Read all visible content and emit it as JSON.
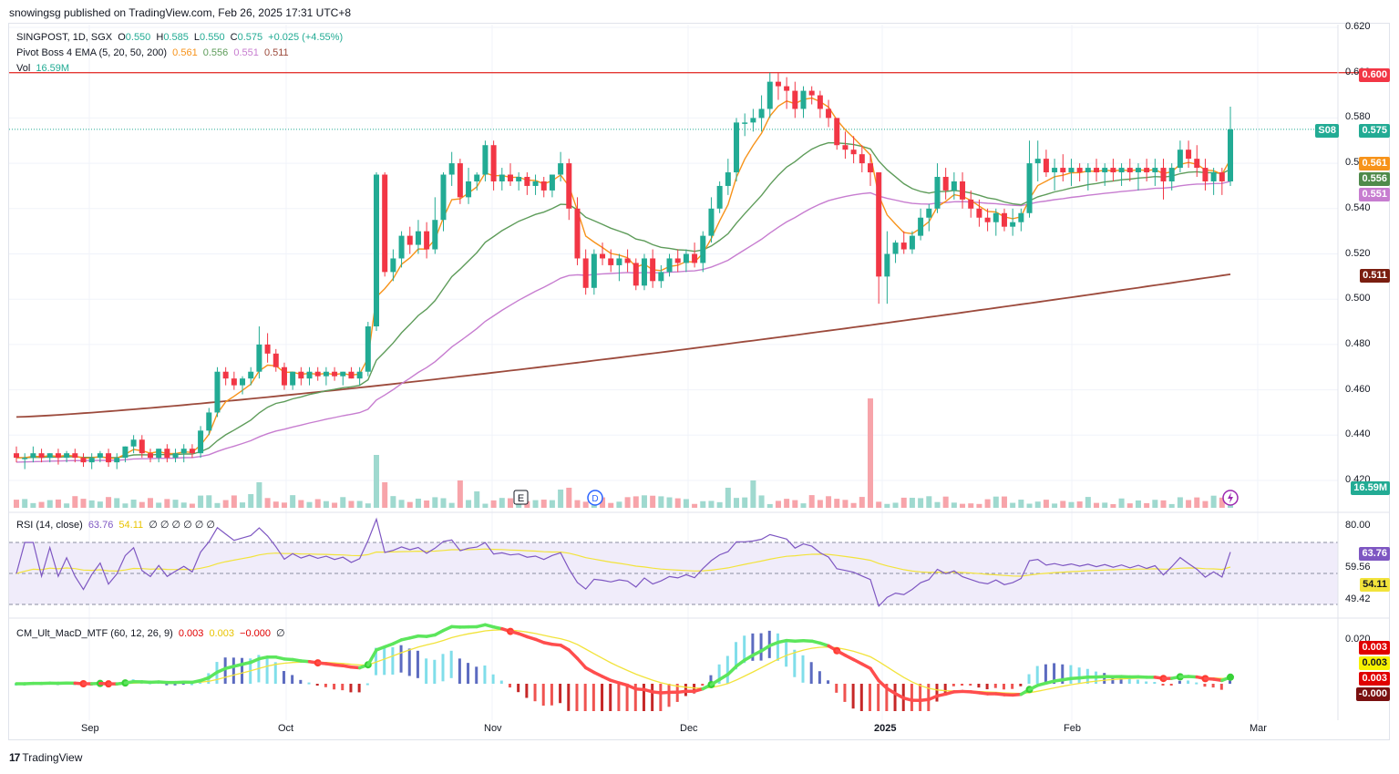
{
  "header": {
    "published": "snowingsg published on TradingView.com, Feb 26, 2025 17:31 UTC+8"
  },
  "brand": {
    "logo": "17",
    "name": "TradingView"
  },
  "legend": {
    "symbol": "SINGPOST, 1D, SGX",
    "o_label": "O",
    "o": "0.550",
    "h_label": "H",
    "h": "0.585",
    "l_label": "L",
    "l": "0.550",
    "c_label": "C",
    "c": "0.575",
    "change": "+0.025 (+4.55%)",
    "ema_title": "Pivot Boss 4 EMA (5, 20, 50, 200)",
    "ema5": "0.561",
    "ema20": "0.556",
    "ema50": "0.551",
    "ema200": "0.511",
    "vol_label": "Vol",
    "vol": "16.59M"
  },
  "rsi_legend": {
    "title": "RSI (14, close)",
    "rsi": "63.76",
    "ma": "54.11",
    "rest": "∅ ∅ ∅ ∅ ∅ ∅"
  },
  "macd_legend": {
    "title": "CM_Ult_MacD_MTF (60, 12, 26, 9)",
    "v1": "0.003",
    "v2": "0.003",
    "v3": "−0.000",
    "rest": "∅"
  },
  "price_axis": [
    "0.620",
    "0.600",
    "0.580",
    "0.560",
    "0.540",
    "0.520",
    "0.500",
    "0.480",
    "0.460",
    "0.440",
    "0.420"
  ],
  "rsi_axis": [
    "80.00",
    "59.56",
    "49.42"
  ],
  "macd_axis": [
    "0.020"
  ],
  "price_labels": {
    "hline": "0.600",
    "ticker": "S08",
    "last": "0.575",
    "ema5": "0.561",
    "ema20": "0.556",
    "ema50": "0.551",
    "ema200": "0.511",
    "vol": "16.59M",
    "rsi": "63.76",
    "rsi_ma": "54.11",
    "macd1": "0.003",
    "macd2": "0.003",
    "macd3": "0.003",
    "macd4": "-0.000"
  },
  "x_axis": [
    "Sep",
    "Oct",
    "Nov",
    "Dec",
    "2025",
    "Feb",
    "Mar"
  ],
  "events": {
    "earnings": "E",
    "dividend": "D"
  },
  "colors": {
    "up": "#22ab94",
    "down": "#f23645",
    "ema5": "#f7931a",
    "ema20": "#5e9c5a",
    "ema50": "#c77dd0",
    "ema200": "#9c4a3c",
    "hline": "#e53935",
    "rsi": "#7e57c2",
    "rsi_ma": "#f2e33b"
  },
  "chart_data": {
    "type": "candlestick",
    "hline": 0.6,
    "candles": [
      [
        0.432,
        0.435,
        0.428,
        0.43
      ],
      [
        0.43,
        0.432,
        0.425,
        0.43
      ],
      [
        0.43,
        0.435,
        0.428,
        0.432
      ],
      [
        0.432,
        0.434,
        0.428,
        0.43
      ],
      [
        0.43,
        0.432,
        0.428,
        0.432
      ],
      [
        0.432,
        0.434,
        0.427,
        0.43
      ],
      [
        0.43,
        0.433,
        0.428,
        0.432
      ],
      [
        0.432,
        0.434,
        0.428,
        0.43
      ],
      [
        0.43,
        0.432,
        0.426,
        0.428
      ],
      [
        0.428,
        0.432,
        0.425,
        0.43
      ],
      [
        0.43,
        0.433,
        0.428,
        0.432
      ],
      [
        0.432,
        0.434,
        0.426,
        0.428
      ],
      [
        0.428,
        0.432,
        0.425,
        0.43
      ],
      [
        0.43,
        0.435,
        0.428,
        0.435
      ],
      [
        0.435,
        0.44,
        0.432,
        0.438
      ],
      [
        0.438,
        0.44,
        0.43,
        0.432
      ],
      [
        0.432,
        0.434,
        0.428,
        0.43
      ],
      [
        0.43,
        0.434,
        0.428,
        0.434
      ],
      [
        0.434,
        0.436,
        0.428,
        0.43
      ],
      [
        0.43,
        0.434,
        0.428,
        0.432
      ],
      [
        0.432,
        0.436,
        0.428,
        0.434
      ],
      [
        0.434,
        0.436,
        0.43,
        0.432
      ],
      [
        0.432,
        0.444,
        0.43,
        0.442
      ],
      [
        0.442,
        0.452,
        0.44,
        0.45
      ],
      [
        0.45,
        0.47,
        0.448,
        0.468
      ],
      [
        0.468,
        0.47,
        0.462,
        0.465
      ],
      [
        0.465,
        0.468,
        0.46,
        0.462
      ],
      [
        0.462,
        0.466,
        0.458,
        0.465
      ],
      [
        0.465,
        0.47,
        0.462,
        0.468
      ],
      [
        0.468,
        0.488,
        0.465,
        0.48
      ],
      [
        0.48,
        0.485,
        0.472,
        0.476
      ],
      [
        0.476,
        0.478,
        0.468,
        0.47
      ],
      [
        0.47,
        0.472,
        0.46,
        0.462
      ],
      [
        0.462,
        0.468,
        0.46,
        0.468
      ],
      [
        0.468,
        0.47,
        0.462,
        0.465
      ],
      [
        0.465,
        0.47,
        0.462,
        0.468
      ],
      [
        0.468,
        0.47,
        0.464,
        0.466
      ],
      [
        0.466,
        0.47,
        0.462,
        0.468
      ],
      [
        0.468,
        0.47,
        0.464,
        0.466
      ],
      [
        0.466,
        0.468,
        0.462,
        0.468
      ],
      [
        0.468,
        0.47,
        0.465,
        0.465
      ],
      [
        0.465,
        0.47,
        0.462,
        0.468
      ],
      [
        0.468,
        0.49,
        0.466,
        0.488
      ],
      [
        0.488,
        0.556,
        0.486,
        0.555
      ],
      [
        0.555,
        0.556,
        0.51,
        0.512
      ],
      [
        0.512,
        0.522,
        0.508,
        0.518
      ],
      [
        0.518,
        0.53,
        0.514,
        0.528
      ],
      [
        0.528,
        0.532,
        0.52,
        0.524
      ],
      [
        0.524,
        0.535,
        0.52,
        0.53
      ],
      [
        0.53,
        0.534,
        0.518,
        0.522
      ],
      [
        0.522,
        0.545,
        0.52,
        0.535
      ],
      [
        0.535,
        0.556,
        0.53,
        0.555
      ],
      [
        0.555,
        0.565,
        0.55,
        0.56
      ],
      [
        0.56,
        0.562,
        0.542,
        0.545
      ],
      [
        0.545,
        0.558,
        0.542,
        0.552
      ],
      [
        0.552,
        0.556,
        0.548,
        0.555
      ],
      [
        0.555,
        0.57,
        0.552,
        0.568
      ],
      [
        0.568,
        0.57,
        0.548,
        0.552
      ],
      [
        0.552,
        0.558,
        0.548,
        0.555
      ],
      [
        0.555,
        0.56,
        0.55,
        0.552
      ],
      [
        0.552,
        0.556,
        0.548,
        0.554
      ],
      [
        0.554,
        0.556,
        0.546,
        0.55
      ],
      [
        0.55,
        0.555,
        0.546,
        0.552
      ],
      [
        0.552,
        0.554,
        0.545,
        0.548
      ],
      [
        0.548,
        0.555,
        0.545,
        0.555
      ],
      [
        0.555,
        0.565,
        0.552,
        0.56
      ],
      [
        0.56,
        0.562,
        0.535,
        0.54
      ],
      [
        0.54,
        0.545,
        0.515,
        0.518
      ],
      [
        0.518,
        0.522,
        0.502,
        0.505
      ],
      [
        0.505,
        0.522,
        0.502,
        0.52
      ],
      [
        0.52,
        0.525,
        0.515,
        0.518
      ],
      [
        0.518,
        0.522,
        0.512,
        0.515
      ],
      [
        0.515,
        0.52,
        0.508,
        0.518
      ],
      [
        0.518,
        0.522,
        0.512,
        0.516
      ],
      [
        0.516,
        0.518,
        0.504,
        0.506
      ],
      [
        0.506,
        0.52,
        0.504,
        0.518
      ],
      [
        0.518,
        0.522,
        0.505,
        0.508
      ],
      [
        0.508,
        0.515,
        0.505,
        0.512
      ],
      [
        0.512,
        0.52,
        0.51,
        0.518
      ],
      [
        0.518,
        0.522,
        0.512,
        0.516
      ],
      [
        0.516,
        0.522,
        0.512,
        0.52
      ],
      [
        0.52,
        0.525,
        0.514,
        0.516
      ],
      [
        0.516,
        0.53,
        0.512,
        0.528
      ],
      [
        0.528,
        0.545,
        0.525,
        0.54
      ],
      [
        0.54,
        0.552,
        0.538,
        0.55
      ],
      [
        0.55,
        0.562,
        0.546,
        0.556
      ],
      [
        0.556,
        0.58,
        0.552,
        0.578
      ],
      [
        0.578,
        0.582,
        0.572,
        0.578
      ],
      [
        0.578,
        0.584,
        0.574,
        0.58
      ],
      [
        0.58,
        0.59,
        0.574,
        0.584
      ],
      [
        0.584,
        0.6,
        0.58,
        0.596
      ],
      [
        0.596,
        0.6,
        0.588,
        0.594
      ],
      [
        0.594,
        0.598,
        0.584,
        0.592
      ],
      [
        0.592,
        0.596,
        0.58,
        0.584
      ],
      [
        0.584,
        0.594,
        0.58,
        0.592
      ],
      [
        0.592,
        0.594,
        0.586,
        0.59
      ],
      [
        0.59,
        0.592,
        0.58,
        0.584
      ],
      [
        0.584,
        0.588,
        0.576,
        0.58
      ],
      [
        0.58,
        0.576,
        0.566,
        0.568
      ],
      [
        0.568,
        0.574,
        0.562,
        0.566
      ],
      [
        0.566,
        0.572,
        0.56,
        0.564
      ],
      [
        0.564,
        0.568,
        0.556,
        0.56
      ],
      [
        0.56,
        0.564,
        0.55,
        0.556
      ],
      [
        0.556,
        0.526,
        0.498,
        0.51
      ],
      [
        0.51,
        0.53,
        0.498,
        0.52
      ],
      [
        0.52,
        0.526,
        0.516,
        0.525
      ],
      [
        0.525,
        0.53,
        0.52,
        0.522
      ],
      [
        0.522,
        0.53,
        0.52,
        0.528
      ],
      [
        0.528,
        0.54,
        0.526,
        0.536
      ],
      [
        0.536,
        0.542,
        0.53,
        0.54
      ],
      [
        0.54,
        0.56,
        0.538,
        0.554
      ],
      [
        0.554,
        0.558,
        0.544,
        0.548
      ],
      [
        0.548,
        0.556,
        0.544,
        0.552
      ],
      [
        0.552,
        0.556,
        0.54,
        0.544
      ],
      [
        0.544,
        0.548,
        0.536,
        0.54
      ],
      [
        0.54,
        0.544,
        0.532,
        0.536
      ],
      [
        0.536,
        0.54,
        0.53,
        0.534
      ],
      [
        0.534,
        0.54,
        0.528,
        0.538
      ],
      [
        0.538,
        0.54,
        0.53,
        0.532
      ],
      [
        0.532,
        0.54,
        0.528,
        0.534
      ],
      [
        0.534,
        0.54,
        0.53,
        0.538
      ],
      [
        0.538,
        0.57,
        0.536,
        0.56
      ],
      [
        0.56,
        0.57,
        0.552,
        0.562
      ],
      [
        0.562,
        0.566,
        0.554,
        0.556
      ],
      [
        0.556,
        0.562,
        0.548,
        0.558
      ],
      [
        0.558,
        0.564,
        0.552,
        0.556
      ],
      [
        0.556,
        0.562,
        0.55,
        0.558
      ],
      [
        0.558,
        0.56,
        0.552,
        0.556
      ],
      [
        0.556,
        0.56,
        0.548,
        0.558
      ],
      [
        0.558,
        0.562,
        0.552,
        0.556
      ],
      [
        0.556,
        0.56,
        0.55,
        0.558
      ],
      [
        0.558,
        0.562,
        0.552,
        0.556
      ],
      [
        0.556,
        0.56,
        0.55,
        0.558
      ],
      [
        0.558,
        0.562,
        0.552,
        0.556
      ],
      [
        0.556,
        0.56,
        0.548,
        0.558
      ],
      [
        0.558,
        0.562,
        0.552,
        0.556
      ],
      [
        0.556,
        0.562,
        0.55,
        0.558
      ],
      [
        0.558,
        0.562,
        0.544,
        0.552
      ],
      [
        0.552,
        0.56,
        0.548,
        0.558
      ],
      [
        0.558,
        0.57,
        0.556,
        0.566
      ],
      [
        0.566,
        0.57,
        0.558,
        0.562
      ],
      [
        0.562,
        0.568,
        0.554,
        0.558
      ],
      [
        0.558,
        0.562,
        0.548,
        0.552
      ],
      [
        0.552,
        0.558,
        0.546,
        0.556
      ],
      [
        0.556,
        0.558,
        0.546,
        0.552
      ],
      [
        0.552,
        0.585,
        0.55,
        0.575
      ]
    ],
    "ema200_start": 0.448,
    "ema200_end": 0.511,
    "ylim": [
      0.41,
      0.625
    ],
    "rsi_last": 63.76,
    "rsi_ma_last": 54.11,
    "rsi_levels": [
      70,
      50
    ]
  }
}
